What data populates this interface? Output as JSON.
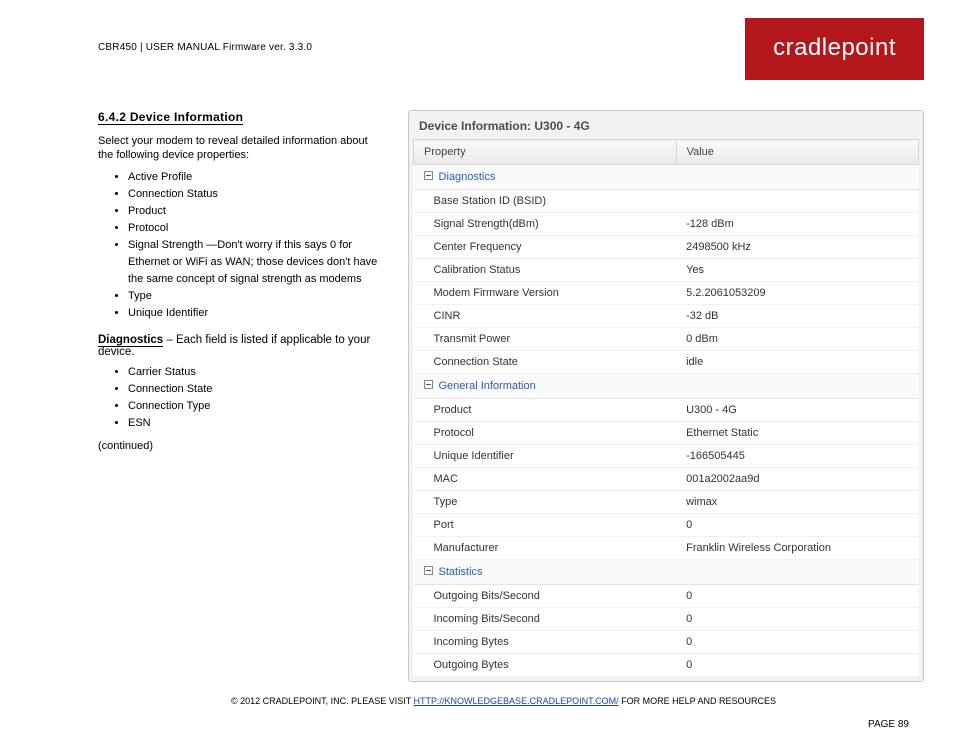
{
  "header": {
    "breadcrumb": "CBR450 | USER MANUAL Firmware ver. 3.3.0",
    "logo": "cradlepoint"
  },
  "left": {
    "section_num_title": "6.4.2 Device Information",
    "para1": "Select your modem to reveal detailed information about the following device properties:",
    "bullets1": [
      "Active Profile",
      "Connection Status",
      "Product",
      "Protocol"
    ],
    "bullet_signal_pre": "Signal Strength",
    "bullet_signal_post": "—Don't worry if this says 0 for Ethernet or WiFi as WAN; those devices don't have the same concept of signal strength as modems",
    "bullets2": [
      "Type",
      "Unique Identifier"
    ],
    "sub_title": "Diagnostics",
    "sub_after": " – Each field is listed if applicable to your device.",
    "bullets3": [
      "Carrier Status",
      "Connection State",
      "Connection Type",
      "ESN"
    ],
    "continued": "(continued)"
  },
  "panel": {
    "title": "Device Information: U300 - 4G",
    "thead": {
      "col1": "Property",
      "col2": "Value"
    },
    "groups": [
      {
        "name": "Diagnostics",
        "rows": [
          {
            "p": "Base Station ID (BSID)",
            "v": ""
          },
          {
            "p": "Signal Strength(dBm)",
            "v": "-128 dBm"
          },
          {
            "p": "Center Frequency",
            "v": "2498500 kHz"
          },
          {
            "p": "Calibration Status",
            "v": "Yes"
          },
          {
            "p": "Modem Firmware Version",
            "v": "5.2.2061053209"
          },
          {
            "p": "CINR",
            "v": "-32 dB"
          },
          {
            "p": "Transmit Power",
            "v": "0 dBm"
          },
          {
            "p": "Connection State",
            "v": "idle"
          }
        ]
      },
      {
        "name": "General Information",
        "rows": [
          {
            "p": "Product",
            "v": "U300 - 4G"
          },
          {
            "p": "Protocol",
            "v": "Ethernet Static"
          },
          {
            "p": "Unique Identifier",
            "v": "-166505445"
          },
          {
            "p": "MAC",
            "v": "001a2002aa9d"
          },
          {
            "p": "Type",
            "v": "wimax"
          },
          {
            "p": "Port",
            "v": "0"
          },
          {
            "p": "Manufacturer",
            "v": "Franklin Wireless Corporation"
          }
        ]
      },
      {
        "name": "Statistics",
        "rows": [
          {
            "p": "Outgoing Bits/Second",
            "v": "0"
          },
          {
            "p": "Incoming Bits/Second",
            "v": "0"
          },
          {
            "p": "Incoming Bytes",
            "v": "0"
          },
          {
            "p": "Outgoing Bytes",
            "v": "0"
          }
        ]
      }
    ]
  },
  "footnote": {
    "l1": "© 2012 CRADLEPOINT, INC.  PLEASE VISIT ",
    "link": "HTTP://KNOWLEDGEBASE.CRADLEPOINT.COM/",
    "l2": "FOR MORE HELP AND RESOURCES",
    "page": "PAGE 89"
  }
}
